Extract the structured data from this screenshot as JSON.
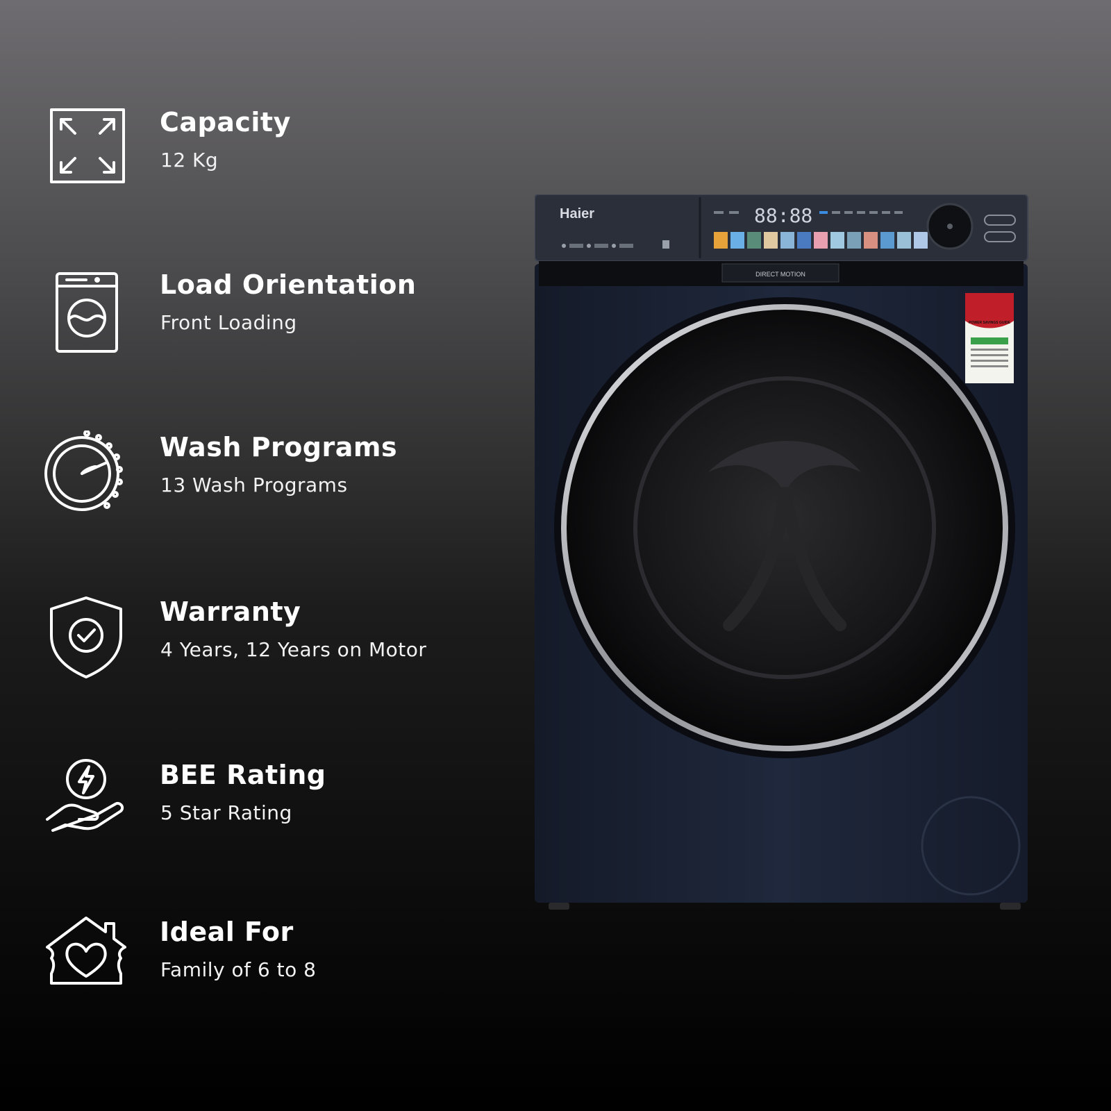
{
  "specs": [
    {
      "icon": "expand-arrows-icon",
      "title": "Capacity",
      "value": "12 Kg"
    },
    {
      "icon": "washing-machine-icon",
      "title": "Load Orientation",
      "value": "Front Loading"
    },
    {
      "icon": "dial-gauge-icon",
      "title": "Wash Programs",
      "value": "13 Wash Programs"
    },
    {
      "icon": "shield-check-icon",
      "title": "Warranty",
      "value": "4 Years, 12 Years on Motor"
    },
    {
      "icon": "energy-hand-icon",
      "title": "BEE Rating",
      "value": "5 Star Rating"
    },
    {
      "icon": "house-heart-icon",
      "title": "Ideal For",
      "value": "Family of 6 to 8"
    }
  ],
  "machine": {
    "brand": "Haier",
    "display": "88:88",
    "strip_label": "DIRECT MOTION",
    "label_heading": "POWER SAVINGS GUIDE",
    "body_color": "#1d2538",
    "panel_color": "#2a2f3a"
  }
}
